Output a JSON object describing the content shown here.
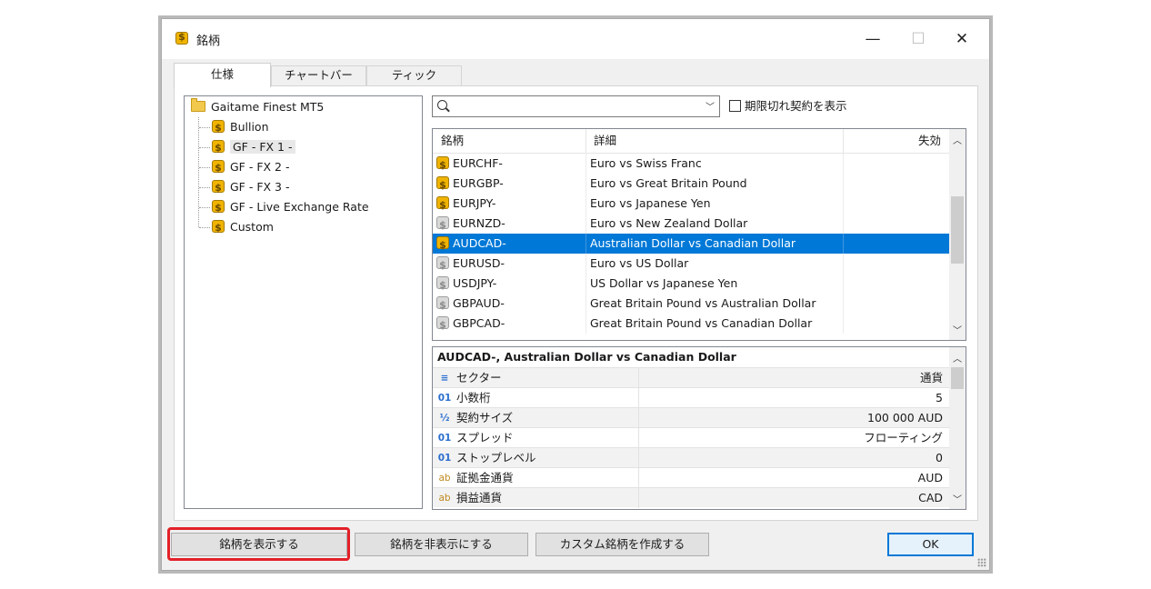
{
  "window": {
    "title": "銘柄"
  },
  "tabs": [
    "仕様",
    "チャートバー",
    "ティック"
  ],
  "tree": {
    "root": "Gaitame Finest MT5",
    "children": [
      "Bullion",
      "GF - FX 1 -",
      "GF - FX 2 -",
      "GF - FX 3 -",
      "GF - Live Exchange Rate",
      "Custom"
    ]
  },
  "search": {
    "value": "",
    "placeholder": ""
  },
  "show_expired_label": "期限切れ契約を表示",
  "grid": {
    "headers": [
      "銘柄",
      "詳細",
      "失効"
    ],
    "rows": [
      {
        "symbol": "EURCHF-",
        "desc": "Euro vs Swiss Franc",
        "active": true
      },
      {
        "symbol": "EURGBP-",
        "desc": "Euro vs Great Britain Pound",
        "active": true
      },
      {
        "symbol": "EURJPY-",
        "desc": "Euro vs Japanese Yen",
        "active": true
      },
      {
        "symbol": "EURNZD-",
        "desc": "Euro vs New Zealand Dollar",
        "active": false
      },
      {
        "symbol": "AUDCAD-",
        "desc": "Australian Dollar vs Canadian Dollar",
        "active": true
      },
      {
        "symbol": "EURUSD-",
        "desc": "Euro vs US Dollar",
        "active": false
      },
      {
        "symbol": "USDJPY-",
        "desc": "US Dollar vs Japanese Yen",
        "active": false
      },
      {
        "symbol": "GBPAUD-",
        "desc": "Great Britain Pound vs Australian Dollar",
        "active": false
      },
      {
        "symbol": "GBPCAD-",
        "desc": "Great Britain Pound vs Canadian Dollar",
        "active": false
      }
    ],
    "selected_index": 4
  },
  "props": {
    "title": "AUDCAD-, Australian Dollar vs Canadian Dollar",
    "rows": [
      {
        "icon": "≡",
        "label": "セクター",
        "value": "通貨"
      },
      {
        "icon": "01",
        "label": "小数桁",
        "value": "5"
      },
      {
        "icon": "½",
        "label": "契約サイズ",
        "value": "100 000 AUD"
      },
      {
        "icon": "01",
        "label": "スプレッド",
        "value": "フローティング"
      },
      {
        "icon": "01",
        "label": "ストップレベル",
        "value": "0"
      },
      {
        "icon": "ab",
        "label": "証拠金通貨",
        "value": "AUD"
      },
      {
        "icon": "ab",
        "label": "損益通貨",
        "value": "CAD"
      }
    ]
  },
  "buttons": {
    "show": "銘柄を表示する",
    "hide": "銘柄を非表示にする",
    "create_custom": "カスタム銘柄を作成する",
    "ok": "OK"
  },
  "colors": {
    "selection": "#0078d7",
    "highlight_frame": "#e3202a",
    "coin_active": "#f0b400",
    "coin_inactive": "#d9d9d9"
  }
}
